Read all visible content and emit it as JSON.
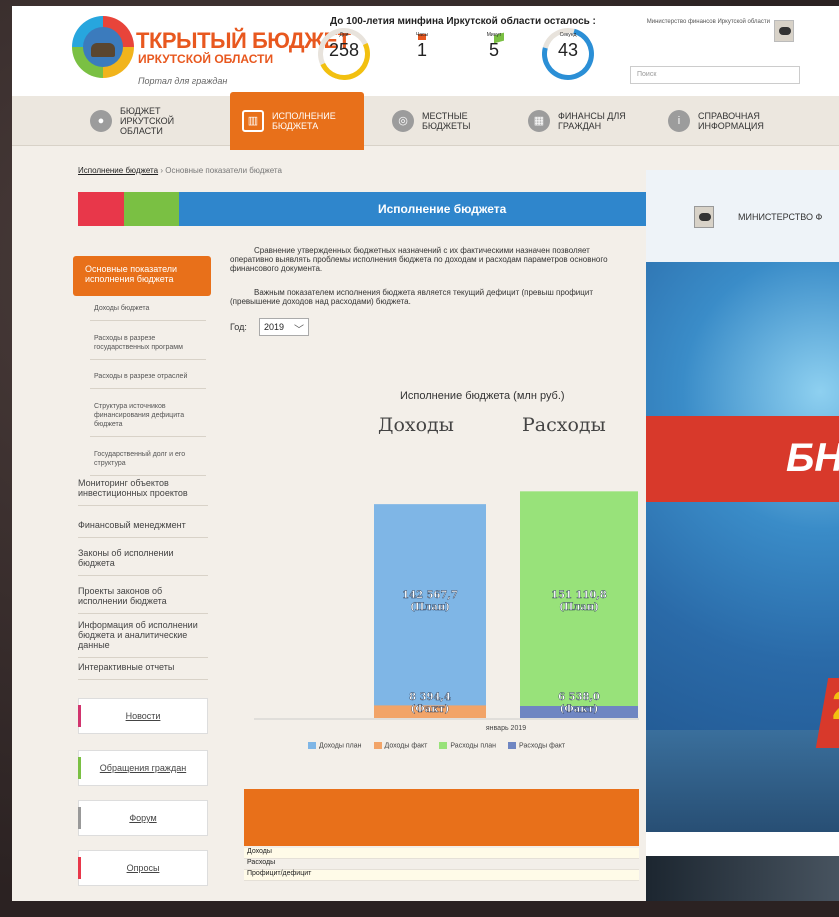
{
  "header": {
    "logo_title": "ТКРЫТЫЙ БЮДЖЕТ",
    "logo_sub": "ИРКУТСКОЙ ОБЛАСТИ",
    "logo_tagline": "Портал для граждан",
    "countdown_title": "До 100-летия минфина Иркутской области осталось :",
    "countdown": [
      {
        "label": "Дни",
        "value": "258"
      },
      {
        "label": "Часы",
        "value": "1"
      },
      {
        "label": "Минут",
        "value": "5"
      },
      {
        "label": "Секунд",
        "value": "43"
      }
    ],
    "ministry": "Министерство финансов Иркутской области",
    "search_placeholder": "Поиск"
  },
  "nav": [
    {
      "label": "БЮДЖЕТ ИРКУТСКОЙ ОБЛАСТИ",
      "icon": "piggy-bank-icon"
    },
    {
      "label": "ИСПОЛНЕНИЕ БЮДЖЕТА",
      "icon": "chart-icon",
      "active": true
    },
    {
      "label": "МЕСТНЫЕ БЮДЖЕТЫ",
      "icon": "map-pin-icon"
    },
    {
      "label": "ФИНАНСЫ ДЛЯ ГРАЖДАН",
      "icon": "money-icon"
    },
    {
      "label": "СПРАВОЧНАЯ ИНФОРМАЦИЯ",
      "icon": "info-icon"
    }
  ],
  "breadcrumb": {
    "link": "Исполнение бюджета",
    "separator": "›",
    "current": "Основные показатели бюджета"
  },
  "banner_title": "Исполнение бюджета",
  "sidebar": {
    "active": "Основные показатели исполнения бюджета",
    "sub_items": [
      "Доходы бюджета",
      "Расходы в разрезе государственных программ",
      "Расходы в разрезе отраслей",
      "Структура источников финансирования дефицита бюджета",
      "Государственный долг и его структура"
    ],
    "main_items": [
      "Мониторинг объектов инвестиционных проектов",
      "Финансовый менеджмент",
      "Законы об исполнении бюджета",
      "Проекты законов об исполнении бюджета",
      "Информация об исполнении бюджета и аналитические данные",
      "Интерактивные отчеты"
    ],
    "buttons": [
      "Новости",
      "Обращения граждан",
      "Форум",
      "Опросы"
    ]
  },
  "content": {
    "para1": "Сравнение утвержденных бюджетных назначений с их фактическими назначен позволяет оперативно выявлять проблемы исполнения бюджета по доходам и расходам параметров основного финансового документа.",
    "para2": "Важным показателем исполнения бюджета является текущий дефицит (превыш профицит (превышение доходов над расходами) бюджета.",
    "year_label": "Год:",
    "year_value": "2019"
  },
  "chart_data": {
    "type": "bar",
    "title": "Исполнение бюджета (млн руб.)",
    "groups": [
      "Доходы",
      "Расходы"
    ],
    "xlabel": "январь 2019",
    "series": [
      {
        "name": "Доходы план",
        "color": "#7fb6e6",
        "value": 142567.7,
        "label": "142 567,7",
        "tag": "(План)"
      },
      {
        "name": "Доходы факт",
        "color": "#f2a468",
        "value": 8394.4,
        "label": "8 394,4",
        "tag": "(Факт)"
      },
      {
        "name": "Расходы план",
        "color": "#98e27a",
        "value": 151110.8,
        "label": "151 110,8",
        "tag": "(План)"
      },
      {
        "name": "Расходы факт",
        "color": "#6f86c2",
        "value": 6538.0,
        "label": "6 538,0",
        "tag": "(Факт)"
      }
    ],
    "legend": [
      "Доходы план",
      "Доходы факт",
      "Расходы план",
      "Расходы факт"
    ],
    "ylim": [
      0,
      160000
    ]
  },
  "table_rows": [
    "Доходы",
    "Расходы",
    "Профицит/дефицит"
  ],
  "overlay": {
    "label": "МИНИСТЕРСТВО Ф",
    "big_text": "БН",
    "num_text": "2"
  }
}
